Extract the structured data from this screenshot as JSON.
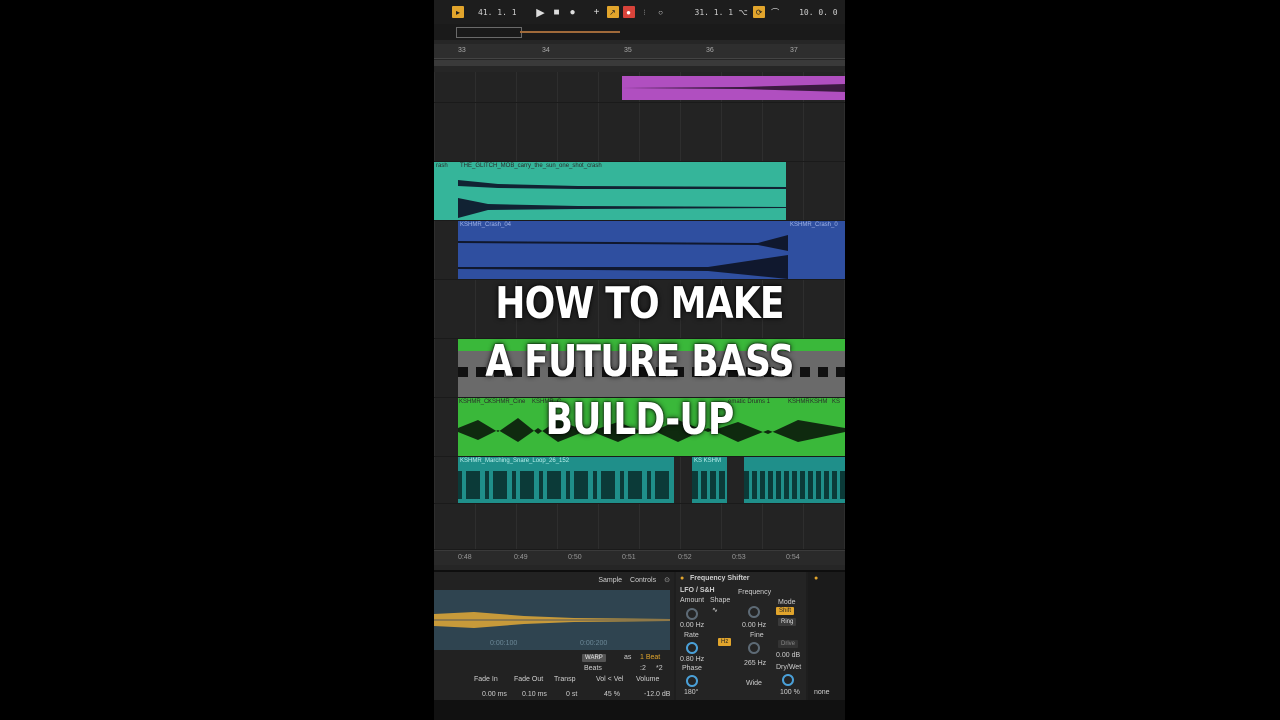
{
  "transport": {
    "position": "41.  1.  1",
    "loop_start": "31.  1.  1",
    "loop_length": "10.  0.  0"
  },
  "ruler": {
    "bars": [
      "33",
      "34",
      "35",
      "36",
      "37"
    ]
  },
  "clips": {
    "crash_left": "rash",
    "crash_main": "THE_GLITCH_MOB_carry_the_sun_one_shot_crash",
    "kshmr_crash": "KSHMR_Crash_04",
    "kshmr_crash_right": "KSHMR_Crash_0",
    "cinematic": [
      "KSHMR_Ci",
      "KSHMR_Cine",
      "KSHMR_C",
      "ematic Drums 1",
      "KSHMR",
      "KSHM",
      "KS"
    ],
    "marching": "KSHMR_Marching_Snare_Loop_26_152",
    "marching_right": "KS KSHM"
  },
  "title": {
    "line1": "HOW TO MAKE",
    "line2": "A FUTURE BASS",
    "line3": "BUILD-UP"
  },
  "timeline": {
    "marks": [
      "0:48",
      "0:49",
      "0:50",
      "0:51",
      "0:52",
      "0:53",
      "0:54"
    ]
  },
  "sample": {
    "tabs": [
      "Sample",
      "Controls"
    ],
    "time_left": "0:00:100",
    "time_right": "0:00:200",
    "warp": "WARP",
    "x_label": "as",
    "beat": "1 Beat",
    "mode": "Beats",
    "half": ":2",
    "double": "*2",
    "params": [
      {
        "label": "Fade In",
        "value": "0.00 ms"
      },
      {
        "label": "Fade Out",
        "value": "0.10 ms"
      },
      {
        "label": "Transp",
        "value": "0 st"
      },
      {
        "label": "Vol < Vel",
        "value": "45 %"
      },
      {
        "label": "Volume",
        "value": "-12.0 dB"
      }
    ]
  },
  "frequency_shifter": {
    "title": "Frequency Shifter",
    "lfo_title": "LFO / S&H",
    "amount": "Amount",
    "shape": "Shape",
    "amount_value": "0.00 Hz",
    "rate": "Rate",
    "rate_value": "0.80 Hz",
    "hz": "Hz",
    "phase": "Phase",
    "phase_value": "180°",
    "frequency": "Frequency",
    "frequency_value": "0.00 Hz",
    "fine": "Fine",
    "fine_value": "265 Hz",
    "mode": "Mode",
    "shift": "Shift",
    "ring": "Ring",
    "drive": "Drive",
    "drive_value": "0.00 dB",
    "drywet": "Dry/Wet",
    "drywet_value": "100 %",
    "wide": "Wide",
    "none": "none"
  },
  "colors": {
    "teal": "#35b59a",
    "blue": "#2f4fa0",
    "green": "#3ab83a",
    "purple": "#b04fc0",
    "orange": "#e2a52c"
  }
}
